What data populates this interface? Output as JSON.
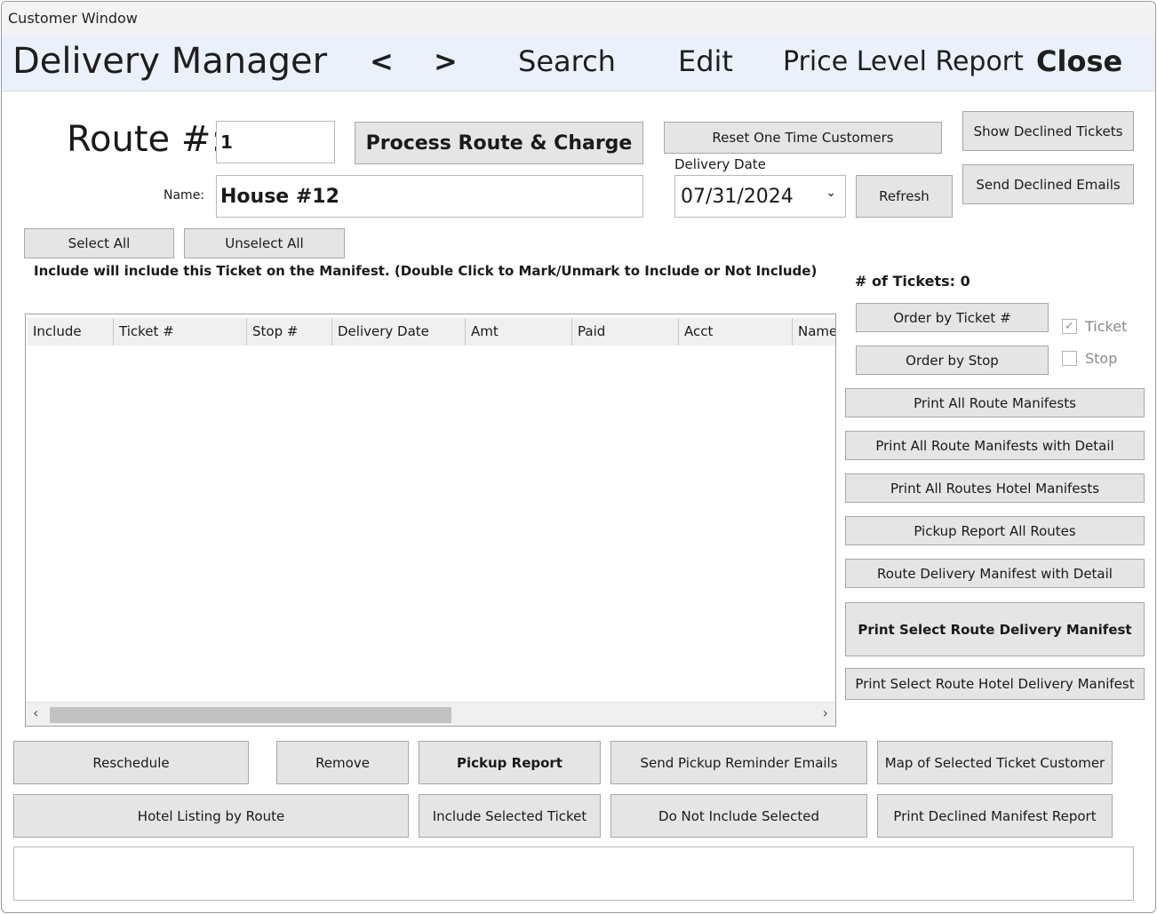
{
  "window": {
    "title": "Customer Window"
  },
  "menu": {
    "app_title": "Delivery Manager",
    "prev": "<",
    "next": ">",
    "search": "Search",
    "edit": "Edit",
    "price_level_report": "Price Level Report",
    "close": "Close"
  },
  "route": {
    "label": "Route #:",
    "number": "1",
    "name_label": "Name:",
    "name": "House #12"
  },
  "buttons": {
    "process_route": "Process Route & Charge",
    "reset_one_time": "Reset One Time Customers",
    "show_declined": "Show Declined Tickets",
    "send_declined": "Send Declined Emails",
    "refresh": "Refresh",
    "select_all": "Select All",
    "unselect_all": "Unselect All",
    "order_by_ticket": "Order by Ticket #",
    "order_by_stop": "Order by Stop",
    "print_all_manifests": "Print All Route Manifests",
    "print_all_manifests_detail": "Print All Route Manifests with Detail",
    "print_all_hotel": "Print All Routes Hotel Manifests",
    "pickup_all_routes": "Pickup Report All Routes",
    "route_delivery_detail": "Route Delivery Manifest with Detail",
    "print_select_route": "Print Select Route Delivery Manifest",
    "print_select_hotel": "Print Select Route Hotel Delivery Manifest",
    "reschedule": "Reschedule",
    "remove": "Remove",
    "pickup_report": "Pickup Report",
    "send_pickup_reminder": "Send Pickup Reminder Emails",
    "map_selected": "Map of Selected Ticket Customer",
    "hotel_listing": "Hotel Listing by Route",
    "include_selected": "Include Selected Ticket",
    "do_not_include": "Do Not Include Selected",
    "print_declined_manifest": "Print Declined Manifest Report"
  },
  "delivery_date": {
    "label": "Delivery Date",
    "value": "07/31/2024"
  },
  "info_text": "Include will include this Ticket on the Manifest. (Double Click to Mark/Unmark to Include or Not Include)",
  "tickets_count": "# of Tickets: 0",
  "sort_options": {
    "ticket": {
      "label": "Ticket",
      "checked": true
    },
    "stop": {
      "label": "Stop",
      "checked": false
    }
  },
  "grid": {
    "columns": [
      "Include",
      "Ticket #",
      "Stop #",
      "Delivery Date",
      "Amt",
      "Paid",
      "Acct",
      "Name"
    ],
    "rows": []
  }
}
